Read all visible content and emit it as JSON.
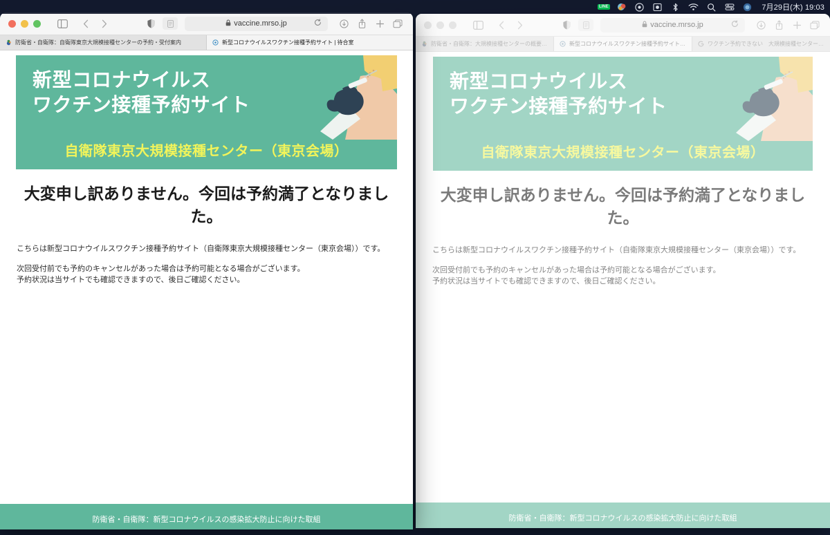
{
  "menubar": {
    "icons": [
      "line-icon",
      "colorful-app-icon",
      "screen-record-icon",
      "display-icon",
      "bluetooth-icon",
      "wifi-icon",
      "search-icon",
      "control-center-icon",
      "siri-icon"
    ],
    "clock": "7月29日(木) 19:03"
  },
  "windows": [
    {
      "id": "window-left",
      "state": "active",
      "toolbar": {
        "sidebar_icon": "sidebar-icon",
        "back_icon": "back-chevron-icon",
        "forward_icon": "forward-chevron-icon",
        "shield_icon": "privacy-shield-icon",
        "reader_icon": "reader-view-icon",
        "lock_icon": "lock-icon",
        "url": "vaccine.mrso.jp",
        "reload_icon": "reload-icon",
        "download_icon": "download-icon",
        "share_icon": "share-icon",
        "newtab_icon": "new-tab-icon",
        "taboverview_icon": "tab-overview-icon"
      },
      "tabs": [
        {
          "label": "防衛省・自衛隊：自衛隊東京大規模接種センターの予約・受付案内",
          "favicon": "defense-ministry-icon",
          "active": false
        },
        {
          "label": "新型コロナウイルスワクチン接種予約サイト | 待合室",
          "favicon": "vaccine-site-icon",
          "active": true
        }
      ]
    },
    {
      "id": "window-right",
      "state": "inactive",
      "toolbar": {
        "sidebar_icon": "sidebar-icon",
        "back_icon": "back-chevron-icon",
        "forward_icon": "forward-chevron-icon",
        "shield_icon": "privacy-shield-icon",
        "reader_icon": "reader-view-icon",
        "lock_icon": "lock-icon",
        "url": "vaccine.mrso.jp",
        "reload_icon": "reload-icon",
        "download_icon": "download-icon",
        "share_icon": "share-icon",
        "newtab_icon": "new-tab-icon",
        "taboverview_icon": "tab-overview-icon"
      },
      "tabs": [
        {
          "label": "防衛省・自衛隊：大規模接種センターの概要　予約サー…",
          "favicon": "defense-ministry-icon",
          "active": false
        },
        {
          "label": "新型コロナウイルスワクチン接種予約サイト | 待合室",
          "favicon": "vaccine-site-icon",
          "active": true
        },
        {
          "label": "ワクチン予約できない　大規模接種センター - Google…",
          "favicon": "google-icon",
          "active": false
        }
      ]
    }
  ],
  "page": {
    "hero": {
      "title_line1": "新型コロナウイルス",
      "title_line2": "ワクチン接種予約サイト",
      "subtitle": "自衛隊東京大規模接種センター（東京会場）",
      "art": "vaccination-injection-illustration",
      "bg_color": "#5fb79c",
      "title_color": "#ffffff",
      "subtitle_color": "#f2f45a"
    },
    "headline": "大変申し訳ありません。今回は予約満了となりました。",
    "paragraphs": [
      "こちらは新型コロナウイルスワクチン接種予約サイト（自衛隊東京大規模接種センター（東京会場））です。",
      "次回受付前でも予約のキャンセルがあった場合は予約可能となる場合がございます。\n予約状況は当サイトでも確認できますので、後日ご確認ください。"
    ],
    "footer": "防衛省・自衛隊：新型コロナウイルスの感染拡大防止に向けた取組"
  }
}
